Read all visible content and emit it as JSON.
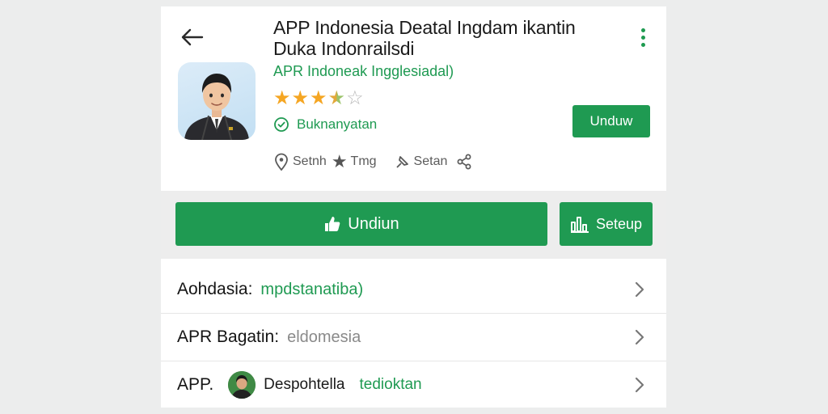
{
  "header": {
    "title": "APP Indonesia Deatal Ingdam ikantin Duka Indonrailsdi",
    "subtitle": "APR Indoneak Ingglesiadal)",
    "rating_stars": 3.5,
    "install_status": "Buknanyatan",
    "install_button_label": "Unduw"
  },
  "meta": {
    "item1": "Setnh",
    "item2": "Tmg",
    "item3": "Setan"
  },
  "actions": {
    "primary_label": "Undiun",
    "secondary_label": "Seteup"
  },
  "rows": [
    {
      "label": "Aohdasia:",
      "value": "mpdstanatiba)"
    },
    {
      "label": "APR Bagatin:",
      "value": "eldomesia"
    },
    {
      "label": "APP.",
      "name": "Despohtella",
      "value": "tedioktan"
    }
  ],
  "colors": {
    "accent": "#1f9a52",
    "background": "#eceded",
    "star_gold": "#f5a623",
    "star_empty": "#b8b8b8"
  }
}
